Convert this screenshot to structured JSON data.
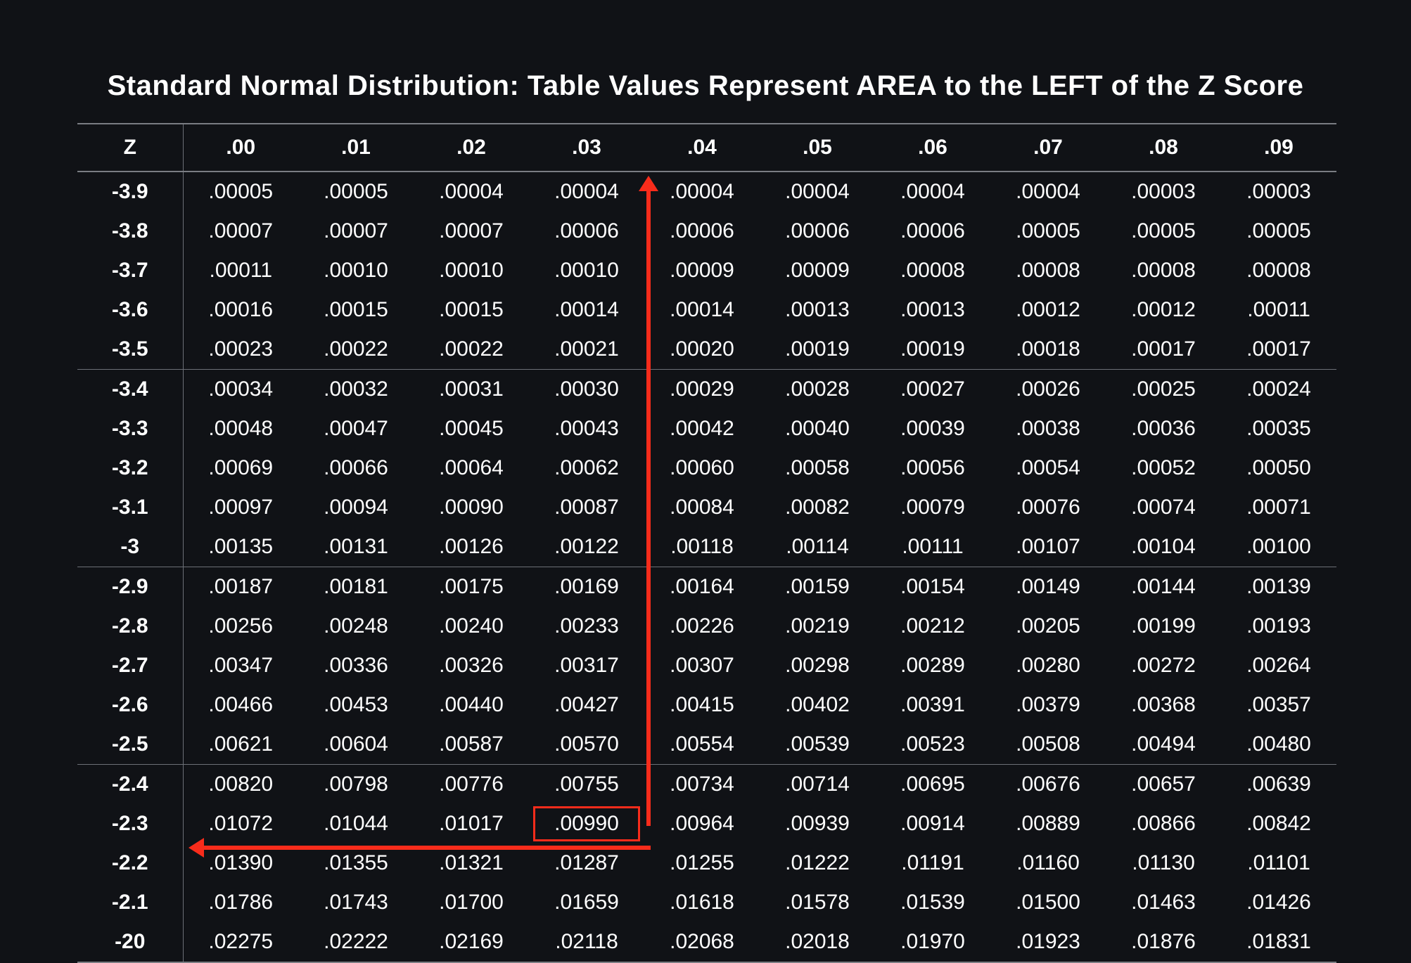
{
  "title": "Standard Normal Distribution: Table Values Represent AREA to the LEFT of the Z Score",
  "columns": [
    "Z",
    ".00",
    ".01",
    ".02",
    ".03",
    ".04",
    ".05",
    ".06",
    ".07",
    ".08",
    ".09"
  ],
  "rows": [
    {
      "z": "-3.9",
      "v": [
        ".00005",
        ".00005",
        ".00004",
        ".00004",
        ".00004",
        ".00004",
        ".00004",
        ".00004",
        ".00003",
        ".00003"
      ]
    },
    {
      "z": "-3.8",
      "v": [
        ".00007",
        ".00007",
        ".00007",
        ".00006",
        ".00006",
        ".00006",
        ".00006",
        ".00005",
        ".00005",
        ".00005"
      ]
    },
    {
      "z": "-3.7",
      "v": [
        ".00011",
        ".00010",
        ".00010",
        ".00010",
        ".00009",
        ".00009",
        ".00008",
        ".00008",
        ".00008",
        ".00008"
      ]
    },
    {
      "z": "-3.6",
      "v": [
        ".00016",
        ".00015",
        ".00015",
        ".00014",
        ".00014",
        ".00013",
        ".00013",
        ".00012",
        ".00012",
        ".00011"
      ]
    },
    {
      "z": "-3.5",
      "v": [
        ".00023",
        ".00022",
        ".00022",
        ".00021",
        ".00020",
        ".00019",
        ".00019",
        ".00018",
        ".00017",
        ".00017"
      ]
    },
    {
      "z": "-3.4",
      "v": [
        ".00034",
        ".00032",
        ".00031",
        ".00030",
        ".00029",
        ".00028",
        ".00027",
        ".00026",
        ".00025",
        ".00024"
      ]
    },
    {
      "z": "-3.3",
      "v": [
        ".00048",
        ".00047",
        ".00045",
        ".00043",
        ".00042",
        ".00040",
        ".00039",
        ".00038",
        ".00036",
        ".00035"
      ]
    },
    {
      "z": "-3.2",
      "v": [
        ".00069",
        ".00066",
        ".00064",
        ".00062",
        ".00060",
        ".00058",
        ".00056",
        ".00054",
        ".00052",
        ".00050"
      ]
    },
    {
      "z": "-3.1",
      "v": [
        ".00097",
        ".00094",
        ".00090",
        ".00087",
        ".00084",
        ".00082",
        ".00079",
        ".00076",
        ".00074",
        ".00071"
      ]
    },
    {
      "z": "-3",
      "v": [
        ".00135",
        ".00131",
        ".00126",
        ".00122",
        ".00118",
        ".00114",
        ".00111",
        ".00107",
        ".00104",
        ".00100"
      ]
    },
    {
      "z": "-2.9",
      "v": [
        ".00187",
        ".00181",
        ".00175",
        ".00169",
        ".00164",
        ".00159",
        ".00154",
        ".00149",
        ".00144",
        ".00139"
      ]
    },
    {
      "z": "-2.8",
      "v": [
        ".00256",
        ".00248",
        ".00240",
        ".00233",
        ".00226",
        ".00219",
        ".00212",
        ".00205",
        ".00199",
        ".00193"
      ]
    },
    {
      "z": "-2.7",
      "v": [
        ".00347",
        ".00336",
        ".00326",
        ".00317",
        ".00307",
        ".00298",
        ".00289",
        ".00280",
        ".00272",
        ".00264"
      ]
    },
    {
      "z": "-2.6",
      "v": [
        ".00466",
        ".00453",
        ".00440",
        ".00427",
        ".00415",
        ".00402",
        ".00391",
        ".00379",
        ".00368",
        ".00357"
      ]
    },
    {
      "z": "-2.5",
      "v": [
        ".00621",
        ".00604",
        ".00587",
        ".00570",
        ".00554",
        ".00539",
        ".00523",
        ".00508",
        ".00494",
        ".00480"
      ]
    },
    {
      "z": "-2.4",
      "v": [
        ".00820",
        ".00798",
        ".00776",
        ".00755",
        ".00734",
        ".00714",
        ".00695",
        ".00676",
        ".00657",
        ".00639"
      ]
    },
    {
      "z": "-2.3",
      "v": [
        ".01072",
        ".01044",
        ".01017",
        ".00990",
        ".00964",
        ".00939",
        ".00914",
        ".00889",
        ".00866",
        ".00842"
      ]
    },
    {
      "z": "-2.2",
      "v": [
        ".01390",
        ".01355",
        ".01321",
        ".01287",
        ".01255",
        ".01222",
        ".01191",
        ".01160",
        ".01130",
        ".01101"
      ]
    },
    {
      "z": "-2.1",
      "v": [
        ".01786",
        ".01743",
        ".01700",
        ".01659",
        ".01618",
        ".01578",
        ".01539",
        ".01500",
        ".01463",
        ".01426"
      ]
    },
    {
      "z": "-20",
      "v": [
        ".02275",
        ".02222",
        ".02169",
        ".02118",
        ".02068",
        ".02018",
        ".01970",
        ".01923",
        ".01876",
        ".01831"
      ]
    }
  ],
  "group_breaks": [
    0,
    5,
    10,
    15
  ],
  "highlight": {
    "row": 16,
    "col": 3
  },
  "chart_data": {
    "type": "table",
    "title": "Standard Normal Distribution: Table Values Represent AREA to the LEFT of the Z Score",
    "row_labels": [
      "-3.9",
      "-3.8",
      "-3.7",
      "-3.6",
      "-3.5",
      "-3.4",
      "-3.3",
      "-3.2",
      "-3.1",
      "-3",
      "-2.9",
      "-2.8",
      "-2.7",
      "-2.6",
      "-2.5",
      "-2.4",
      "-2.3",
      "-2.2",
      "-2.1",
      "-20"
    ],
    "col_labels": [
      ".00",
      ".01",
      ".02",
      ".03",
      ".04",
      ".05",
      ".06",
      ".07",
      ".08",
      ".09"
    ],
    "values": [
      [
        5e-05,
        5e-05,
        4e-05,
        4e-05,
        4e-05,
        4e-05,
        4e-05,
        4e-05,
        3e-05,
        3e-05
      ],
      [
        7e-05,
        7e-05,
        7e-05,
        6e-05,
        6e-05,
        6e-05,
        6e-05,
        5e-05,
        5e-05,
        5e-05
      ],
      [
        0.00011,
        0.0001,
        0.0001,
        0.0001,
        9e-05,
        9e-05,
        8e-05,
        8e-05,
        8e-05,
        8e-05
      ],
      [
        0.00016,
        0.00015,
        0.00015,
        0.00014,
        0.00014,
        0.00013,
        0.00013,
        0.00012,
        0.00012,
        0.00011
      ],
      [
        0.00023,
        0.00022,
        0.00022,
        0.00021,
        0.0002,
        0.00019,
        0.00019,
        0.00018,
        0.00017,
        0.00017
      ],
      [
        0.00034,
        0.00032,
        0.00031,
        0.0003,
        0.00029,
        0.00028,
        0.00027,
        0.00026,
        0.00025,
        0.00024
      ],
      [
        0.00048,
        0.00047,
        0.00045,
        0.00043,
        0.00042,
        0.0004,
        0.00039,
        0.00038,
        0.00036,
        0.00035
      ],
      [
        0.00069,
        0.00066,
        0.00064,
        0.00062,
        0.0006,
        0.00058,
        0.00056,
        0.00054,
        0.00052,
        0.0005
      ],
      [
        0.00097,
        0.00094,
        0.0009,
        0.00087,
        0.00084,
        0.00082,
        0.00079,
        0.00076,
        0.00074,
        0.00071
      ],
      [
        0.00135,
        0.00131,
        0.00126,
        0.00122,
        0.00118,
        0.00114,
        0.00111,
        0.00107,
        0.00104,
        0.001
      ],
      [
        0.00187,
        0.00181,
        0.00175,
        0.00169,
        0.00164,
        0.00159,
        0.00154,
        0.00149,
        0.00144,
        0.00139
      ],
      [
        0.00256,
        0.00248,
        0.0024,
        0.00233,
        0.00226,
        0.00219,
        0.00212,
        0.00205,
        0.00199,
        0.00193
      ],
      [
        0.00347,
        0.00336,
        0.00326,
        0.00317,
        0.00307,
        0.00298,
        0.00289,
        0.0028,
        0.00272,
        0.00264
      ],
      [
        0.00466,
        0.00453,
        0.0044,
        0.00427,
        0.00415,
        0.00402,
        0.00391,
        0.00379,
        0.00368,
        0.00357
      ],
      [
        0.00621,
        0.00604,
        0.00587,
        0.0057,
        0.00554,
        0.00539,
        0.00523,
        0.00508,
        0.00494,
        0.0048
      ],
      [
        0.0082,
        0.00798,
        0.00776,
        0.00755,
        0.00734,
        0.00714,
        0.00695,
        0.00676,
        0.00657,
        0.00639
      ],
      [
        0.01072,
        0.01044,
        0.01017,
        0.0099,
        0.00964,
        0.00939,
        0.00914,
        0.00889,
        0.00866,
        0.00842
      ],
      [
        0.0139,
        0.01355,
        0.01321,
        0.01287,
        0.01255,
        0.01222,
        0.01191,
        0.0116,
        0.0113,
        0.01101
      ],
      [
        0.01786,
        0.01743,
        0.017,
        0.01659,
        0.01618,
        0.01578,
        0.01539,
        0.015,
        0.01463,
        0.01426
      ],
      [
        0.02275,
        0.02222,
        0.02169,
        0.02118,
        0.02068,
        0.02018,
        0.0197,
        0.01923,
        0.01876,
        0.01831
      ]
    ],
    "highlighted_cell": {
      "row_label": "-2.3",
      "col_label": ".03",
      "value": 0.0099
    },
    "annotations": [
      "red arrow up column .03",
      "red arrow left along row -2.3",
      "red box around .00990"
    ]
  }
}
